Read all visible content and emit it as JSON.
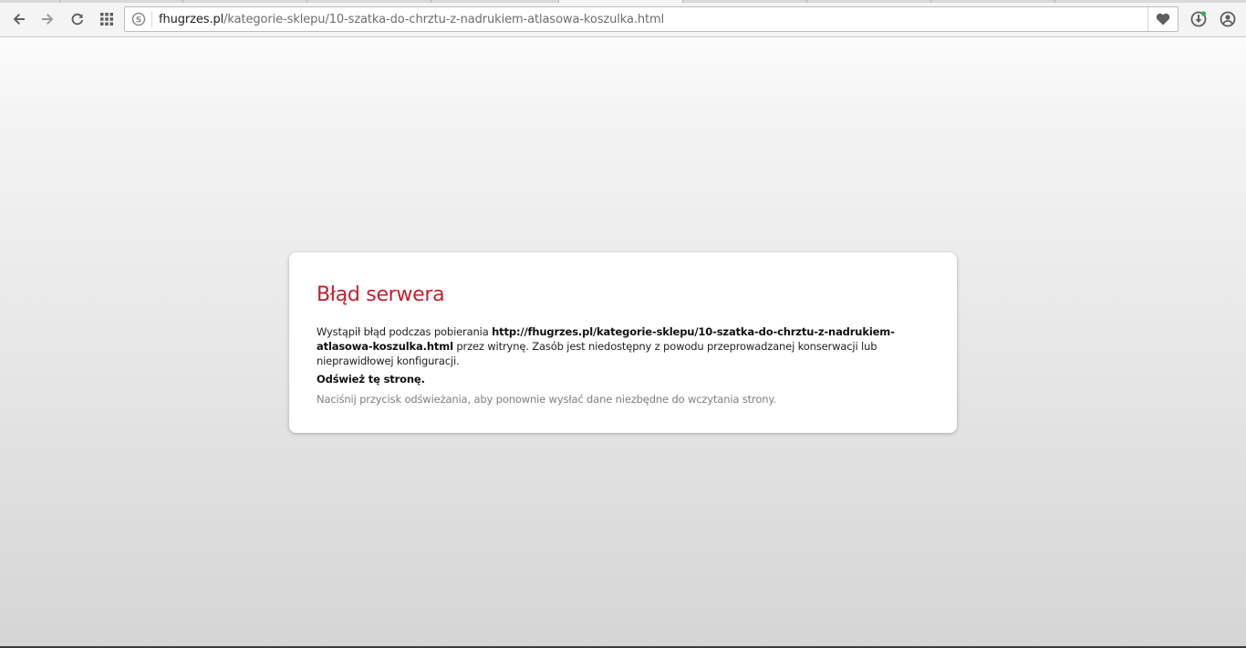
{
  "browser": {
    "url_host": "fhugrzes.pl",
    "url_path": "/kategorie-sklepu/10-szatka-do-chrztu-z-nadrukiem-atlasowa-koszulka.html",
    "icons": {
      "back": "arrow-left-icon",
      "forward": "arrow-right-icon",
      "reload": "reload-icon",
      "speed_dial": "grid-icon",
      "site_info": "site-info-icon",
      "stash": "heart-icon",
      "downloads": "download-icon",
      "profile": "profile-icon"
    },
    "colors": {
      "download_badge": "#2bb34a"
    }
  },
  "error": {
    "title": "Błąd serwera",
    "desc_prefix": "Wystąpił błąd podczas pobierania ",
    "desc_url": "http://fhugrzes.pl/kategorie-sklepu/10-szatka-do-chrztu-z-nadrukiem-atlasowa-koszulka.html",
    "desc_suffix": " przez witrynę. Zasób jest niedostępny z powodu przeprowadzanej konserwacji lub nieprawidłowej konfiguracji.",
    "subheading": "Odśwież tę stronę.",
    "hint": "Naciśnij przycisk odświeżania, aby ponownie wysłać dane niezbędne do wczytania strony.",
    "colors": {
      "title": "#c41f2b"
    }
  }
}
